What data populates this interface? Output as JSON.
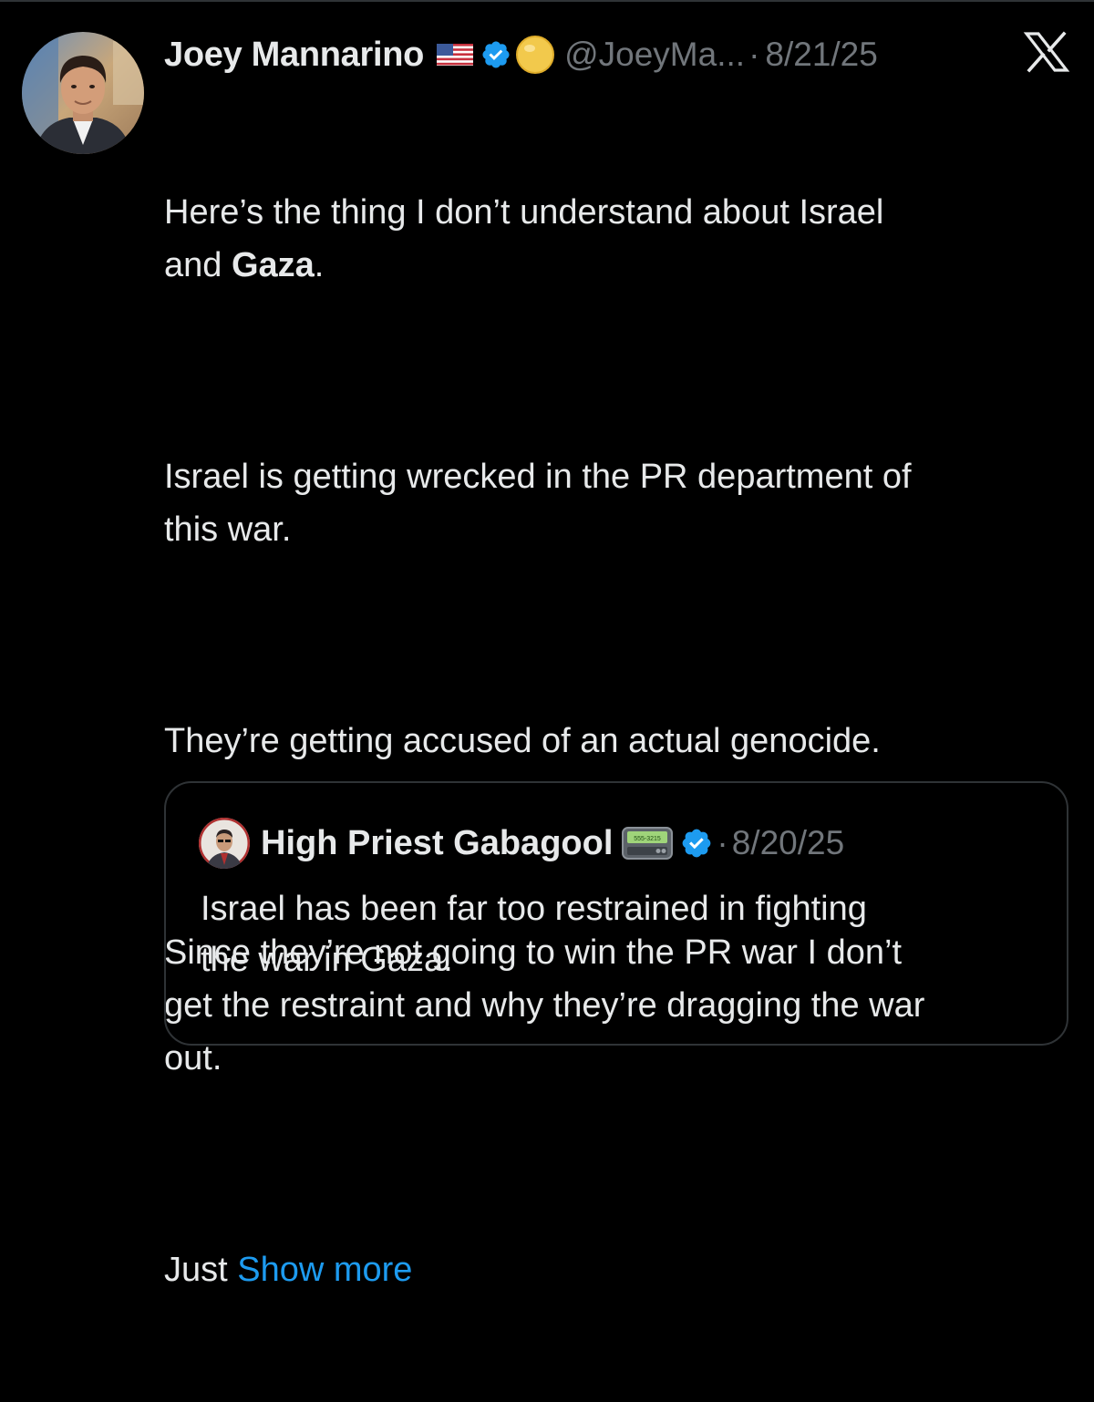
{
  "tweet": {
    "author": {
      "display_name": "Joey Mannarino",
      "handle": "@JoeyMa...",
      "badges": [
        "us-flag-icon",
        "verified-badge-icon",
        "yellow-circle-icon"
      ]
    },
    "separator": "·",
    "timestamp": "8/21/25",
    "body": {
      "line1_before": "Here’s the thing I don’t understand about Israel\nand ",
      "line1_bold": "Gaza",
      "line1_after": ".",
      "para2": "Israel is getting wrecked in the PR department of\nthis war.",
      "para3": "They’re getting accused of an actual genocide.",
      "para4": "Since they’re not going to win the PR war I don’t\nget the restraint and why they’re dragging the war\nout.",
      "para5_text": "Just ",
      "show_more": "Show more"
    }
  },
  "quoted_tweet": {
    "author": {
      "display_name": "High Priest Gabagool",
      "badges": [
        "pager-icon",
        "verified-badge-icon"
      ],
      "pager_text": "555-3215"
    },
    "separator": "·",
    "timestamp": "8/20/25",
    "body": "Israel has been far too restrained in fighting\nthe war in Gaza."
  },
  "platform": {
    "logo": "x-logo-icon"
  },
  "colors": {
    "background": "#000000",
    "text": "#e7e9ea",
    "muted": "#71767b",
    "link": "#1d9bf0",
    "verified": "#1d9bf0",
    "border": "#2f3336"
  }
}
